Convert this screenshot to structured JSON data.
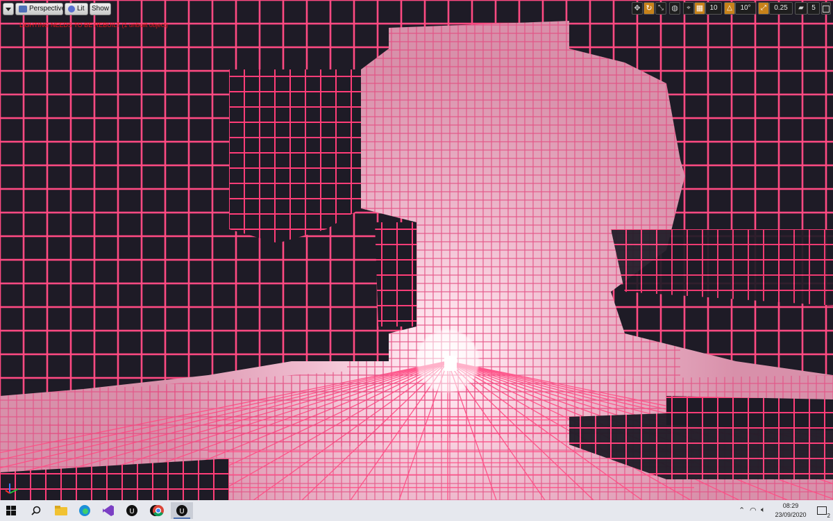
{
  "viewport": {
    "perspective_label": "Perspective",
    "lit_label": "Lit",
    "show_label": "Show",
    "warning_text": "LIGHTING NEEDS TO BE REBUILT (1 unbuilt object)",
    "grid_snap_value": "10",
    "rotation_snap_value": "10°",
    "scale_snap_value": "0.25",
    "camera_speed_value": "5",
    "colors": {
      "neon_edge": "#ff3d78",
      "block_dark": "#1c1a24",
      "haze": "#f3c6d6",
      "warning": "#e01818",
      "snap_active": "#c8821a"
    }
  },
  "taskbar": {
    "clock_time": "08:29",
    "clock_date": "23/09/2020",
    "notification_badge": "2",
    "apps": [
      "windows-start",
      "search",
      "file-explorer",
      "edge",
      "visual-studio",
      "unreal-engine",
      "unreal-engine",
      "chrome",
      "unreal-engine"
    ]
  }
}
